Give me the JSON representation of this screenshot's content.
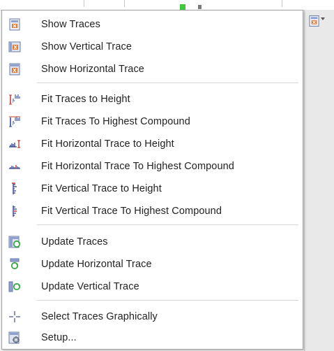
{
  "menu": {
    "groups": [
      {
        "items": [
          {
            "label": "Show Traces",
            "icon": "show-traces-icon"
          },
          {
            "label": "Show Vertical Trace",
            "icon": "show-vertical-trace-icon"
          },
          {
            "label": "Show Horizontal Trace",
            "icon": "show-horizontal-trace-icon"
          }
        ]
      },
      {
        "items": [
          {
            "label": "Fit Traces to Height",
            "icon": "fit-traces-height-icon"
          },
          {
            "label": "Fit Traces To Highest Compound",
            "icon": "fit-traces-highest-icon"
          },
          {
            "label": "Fit Horizontal Trace to Height",
            "icon": "fit-horizontal-height-icon"
          },
          {
            "label": "Fit Horizontal Trace To Highest Compound",
            "icon": "fit-horizontal-highest-icon"
          },
          {
            "label": "Fit Vertical Trace to Height",
            "icon": "fit-vertical-height-icon"
          },
          {
            "label": "Fit Vertical Trace To Highest Compound",
            "icon": "fit-vertical-highest-icon"
          }
        ]
      },
      {
        "items": [
          {
            "label": "Update Traces",
            "icon": "update-traces-icon"
          },
          {
            "label": "Update Horizontal Trace",
            "icon": "update-horizontal-trace-icon"
          },
          {
            "label": "Update Vertical Trace",
            "icon": "update-vertical-trace-icon"
          }
        ]
      },
      {
        "items": [
          {
            "label": "Select Traces Graphically",
            "icon": "crosshair-icon"
          },
          {
            "label": "Setup...",
            "icon": "setup-icon"
          }
        ]
      }
    ]
  },
  "colors": {
    "accent_orange": "#e8742a",
    "trace_blue": "#2a3f8f",
    "trace_red": "#c0392b",
    "update_green": "#3aa64a"
  }
}
